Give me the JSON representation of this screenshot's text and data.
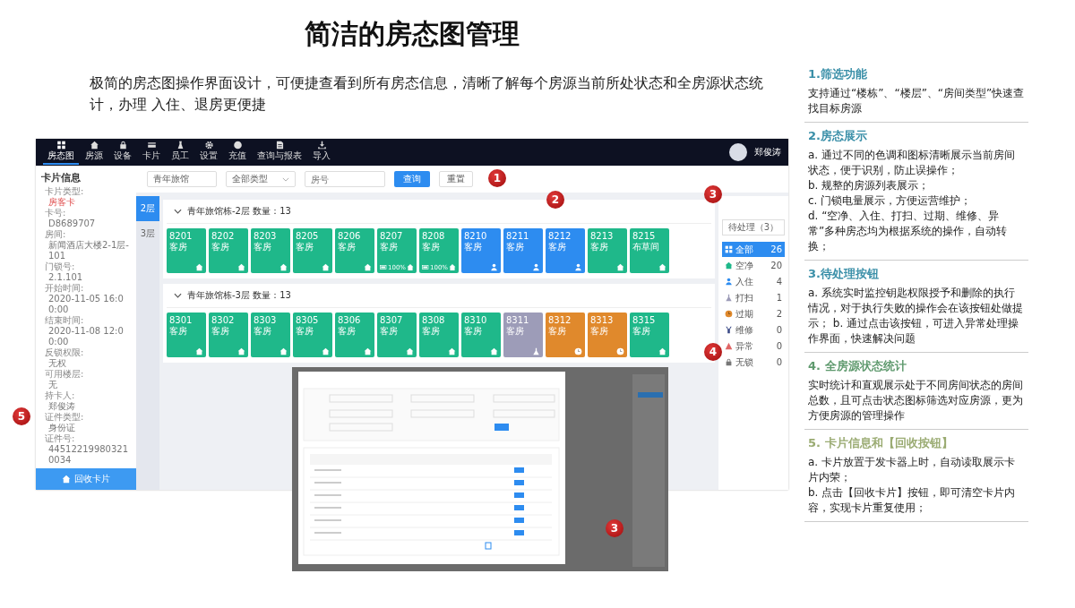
{
  "title": "简洁的房态图管理",
  "intro": "极简的房态图操作界面设计，可便捷查看到所有房态信息，清晰了解每个房源当前所处状态和全房源状态统计，办理 入住、退房更便捷",
  "app": {
    "nav": [
      {
        "label": "房态图",
        "selected": true
      },
      {
        "label": "房源",
        "selected": false
      },
      {
        "label": "设备",
        "selected": false
      },
      {
        "label": "卡片",
        "selected": false
      },
      {
        "label": "员工",
        "selected": false
      },
      {
        "label": "设置",
        "selected": false
      },
      {
        "label": "充值",
        "selected": false
      },
      {
        "label": "查询与报表",
        "selected": false
      },
      {
        "label": "导入",
        "selected": false
      }
    ],
    "user": {
      "name": "郑俊涛"
    },
    "card_info": {
      "title": "卡片信息",
      "fields": [
        {
          "label": "卡片类型:",
          "value": "房客卡",
          "highlight": true
        },
        {
          "label": "卡号:",
          "value": "D8689707",
          "highlight": false
        },
        {
          "label": "房间:",
          "value": "新闻酒店大楼2-1层-101",
          "highlight": false
        },
        {
          "label": "门锁号:",
          "value": "2.1.101",
          "highlight": false
        },
        {
          "label": "开始时间:",
          "value": "2020-11-05 16:00:00",
          "highlight": false
        },
        {
          "label": "结束时间:",
          "value": "2020-11-08 12:00:00",
          "highlight": false
        },
        {
          "label": "反锁权限:",
          "value": "无权",
          "highlight": false
        },
        {
          "label": "可用楼层:",
          "value": "无",
          "highlight": false
        },
        {
          "label": "持卡人:",
          "value": "郑俊涛",
          "highlight": false
        },
        {
          "label": "证件类型:",
          "value": "身份证",
          "highlight": false
        },
        {
          "label": "证件号:",
          "value": "445122199803210034",
          "highlight": false
        }
      ],
      "button": "回收卡片"
    },
    "filters": {
      "building": "青年旅馆",
      "room_type": "全部类型",
      "room_placeholder": "房号",
      "search_button": "查询",
      "reset_button": "重置"
    },
    "floor_tabs": [
      {
        "label": "2层",
        "selected": true
      },
      {
        "label": "3层",
        "selected": false
      }
    ],
    "floors": [
      {
        "title": "青年旅馆栋-2层 数量：13",
        "rooms": [
          {
            "number": "8201",
            "type": "客房",
            "kind": "vacant"
          },
          {
            "number": "8202",
            "type": "客房",
            "kind": "vacant"
          },
          {
            "number": "8203",
            "type": "客房",
            "kind": "vacant"
          },
          {
            "number": "8205",
            "type": "客房",
            "kind": "vacant"
          },
          {
            "number": "8206",
            "type": "客房",
            "kind": "vacant"
          },
          {
            "number": "8207",
            "type": "客房",
            "kind": "vacant",
            "battery": "100%"
          },
          {
            "number": "8208",
            "type": "客房",
            "kind": "vacant",
            "battery": "100%"
          },
          {
            "number": "8210",
            "type": "客房",
            "kind": "occupied"
          },
          {
            "number": "8211",
            "type": "客房",
            "kind": "occupied"
          },
          {
            "number": "8212",
            "type": "客房",
            "kind": "occupied"
          },
          {
            "number": "8213",
            "type": "客房",
            "kind": "vacant"
          },
          {
            "number": "8215",
            "type": "布草间",
            "kind": "vacant"
          }
        ]
      },
      {
        "title": "青年旅馆栋-3层 数量：13",
        "rooms": [
          {
            "number": "8301",
            "type": "客房",
            "kind": "vacant"
          },
          {
            "number": "8302",
            "type": "客房",
            "kind": "vacant"
          },
          {
            "number": "8303",
            "type": "客房",
            "kind": "vacant"
          },
          {
            "number": "8305",
            "type": "客房",
            "kind": "vacant"
          },
          {
            "number": "8306",
            "type": "客房",
            "kind": "vacant"
          },
          {
            "number": "8307",
            "type": "客房",
            "kind": "vacant"
          },
          {
            "number": "8308",
            "type": "客房",
            "kind": "vacant"
          },
          {
            "number": "8310",
            "type": "客房",
            "kind": "vacant"
          },
          {
            "number": "8311",
            "type": "客房",
            "kind": "cleaning"
          },
          {
            "number": "8312",
            "type": "客房",
            "kind": "expired"
          },
          {
            "number": "8313",
            "type": "客房",
            "kind": "expired"
          },
          {
            "number": "8315",
            "type": "客房",
            "kind": "vacant"
          }
        ]
      }
    ],
    "pending_button": "待处理（3）",
    "stats": [
      {
        "kind": "all",
        "label": "全部",
        "count": "26",
        "selected": true
      },
      {
        "kind": "vacant",
        "label": "空净",
        "count": "20",
        "selected": false
      },
      {
        "kind": "occupied",
        "label": "入住",
        "count": "4",
        "selected": false
      },
      {
        "kind": "cleaning",
        "label": "打扫",
        "count": "1",
        "selected": false
      },
      {
        "kind": "expired",
        "label": "过期",
        "count": "2",
        "selected": false
      },
      {
        "kind": "repair",
        "label": "维修",
        "count": "0",
        "selected": false
      },
      {
        "kind": "abnormal",
        "label": "异常",
        "count": "0",
        "selected": false
      },
      {
        "kind": "nolock",
        "label": "无锁",
        "count": "0",
        "selected": false
      }
    ],
    "markers": [
      "1",
      "2",
      "3",
      "4",
      "5"
    ]
  },
  "dialog": {
    "marker": "3"
  },
  "notes": [
    {
      "heading": "1.筛选功能",
      "color": "#3a8fa8",
      "paragraphs": [
        "支持通过“楼栋”、“楼层”、“房间类型”快速查找目标房源"
      ]
    },
    {
      "heading": "2.房态展示",
      "color": "#3a8fa8",
      "paragraphs": [
        "a. 通过不同的色调和图标清晰展示当前房间状态，便于识别，防止误操作；",
        "b. 规整的房源列表展示；",
        "c. 门锁电量展示，方便运营维护；",
        "d. “空净、入住、打扫、过期、维修、异常”多种房态均为根据系统的操作，自动转换；"
      ]
    },
    {
      "heading": "3.待处理按钮",
      "color": "#3a8fa8",
      "paragraphs": [
        "a. 系统实时监控钥匙权限授予和删除的执行情况，对于执行失败的操作会在该按钮处做提示； b. 通过点击该按钮，可进入异常处理操作界面，快速解决问题"
      ]
    },
    {
      "heading": "4. 全房源状态统计",
      "color": "#5f9a6e",
      "paragraphs": [
        "实时统计和直观展示处于不同房间状态的房间总数，且可点击状态图标筛选对应房源，更为方便房源的管理操作"
      ]
    },
    {
      "heading": "5. 卡片信息和【回收按钮】",
      "color": "#9aab72",
      "paragraphs": [
        "a. 卡片放置于发卡器上时，自动读取展示卡片内荣；",
        "b. 点击【回收卡片】按钮，即可清空卡片内容，实现卡片重复使用；"
      ]
    }
  ]
}
